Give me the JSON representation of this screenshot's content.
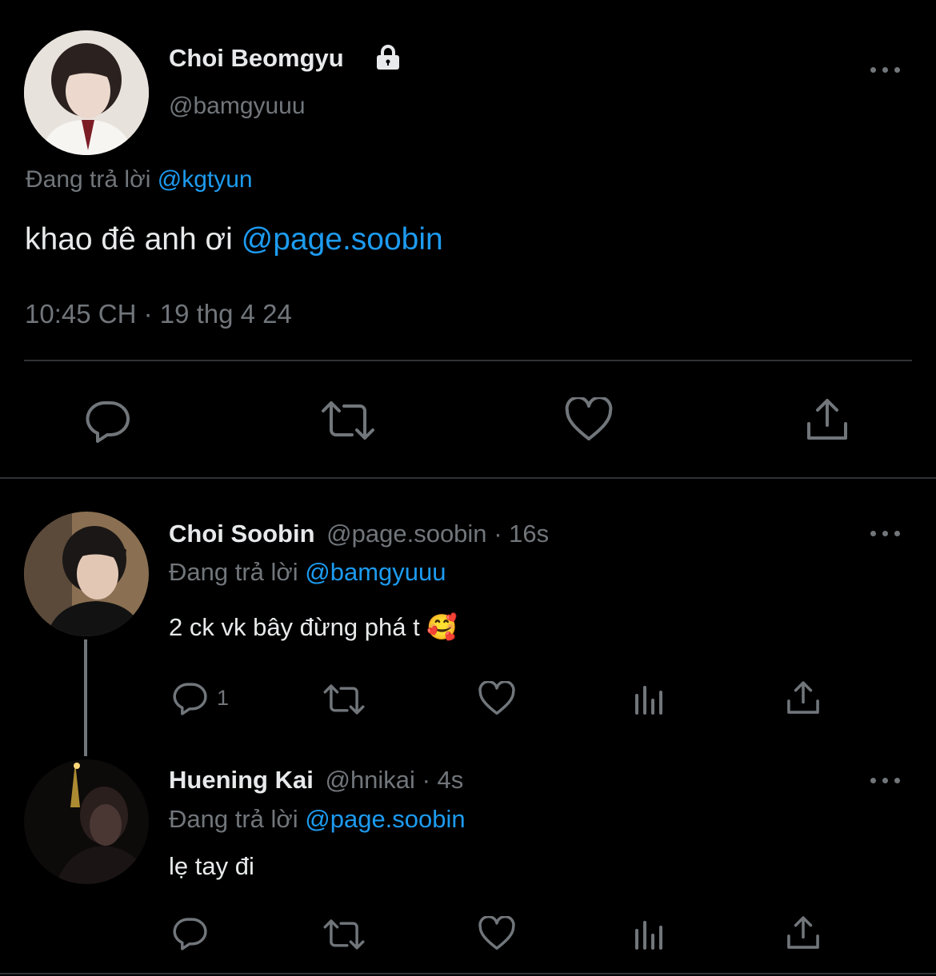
{
  "main_tweet": {
    "author_name": "Choi Beomgyu",
    "author_handle": "@bamgyuuu",
    "reply_prefix": "Đang trả lời",
    "reply_to": "@kgtyun",
    "text": "khao đê anh ơi",
    "mention": "@page.soobin",
    "timestamp": "10:45 CH · 19 thg 4 24",
    "icons": [
      "reply-icon",
      "retweet-icon",
      "like-icon",
      "share-icon"
    ]
  },
  "replies": [
    {
      "author_name": "Choi Soobin",
      "author_handle": "@page.soobin",
      "time": "· 16s",
      "reply_prefix": "Đang trả lời",
      "reply_to": "@bamgyuuu",
      "text": "2 ck vk bây đừng phá t",
      "emoji": "🥰",
      "reply_count": "1"
    },
    {
      "author_name": "Huening Kai",
      "author_handle": "@hnikai",
      "time": "· 4s",
      "reply_prefix": "Đang trả lời",
      "reply_to": "@page.soobin",
      "text": "lẹ tay đi"
    }
  ],
  "colors": {
    "background": "#000000",
    "text": "#e7e9ea",
    "muted": "#71767b",
    "link": "#1d9bf0",
    "divider": "#2f3336"
  }
}
